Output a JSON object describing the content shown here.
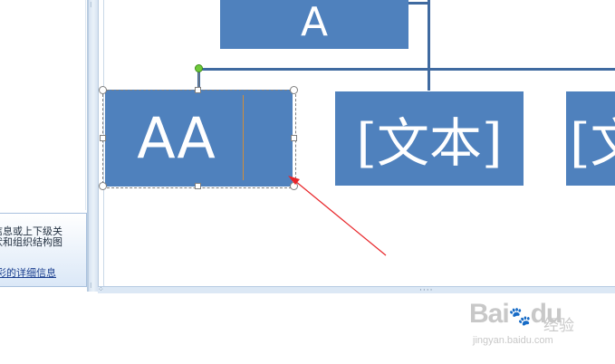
{
  "info_panel": {
    "line1": "信息或上下级关",
    "line2": "状和组织结构图",
    "link": "彩的详细信息"
  },
  "nodes": {
    "top": "A",
    "selected": "AA",
    "text1": "[文本]",
    "text2": "[文"
  },
  "watermark": {
    "logo": "Bai",
    "logo_suffix": "du",
    "cn": "经验",
    "url": "jingyan.baidu.com"
  },
  "colors": {
    "node_fill": "#4f81bd",
    "connector": "#3f6aa0",
    "arrow": "#e8262a",
    "rotate_handle": "#6fca3a"
  }
}
